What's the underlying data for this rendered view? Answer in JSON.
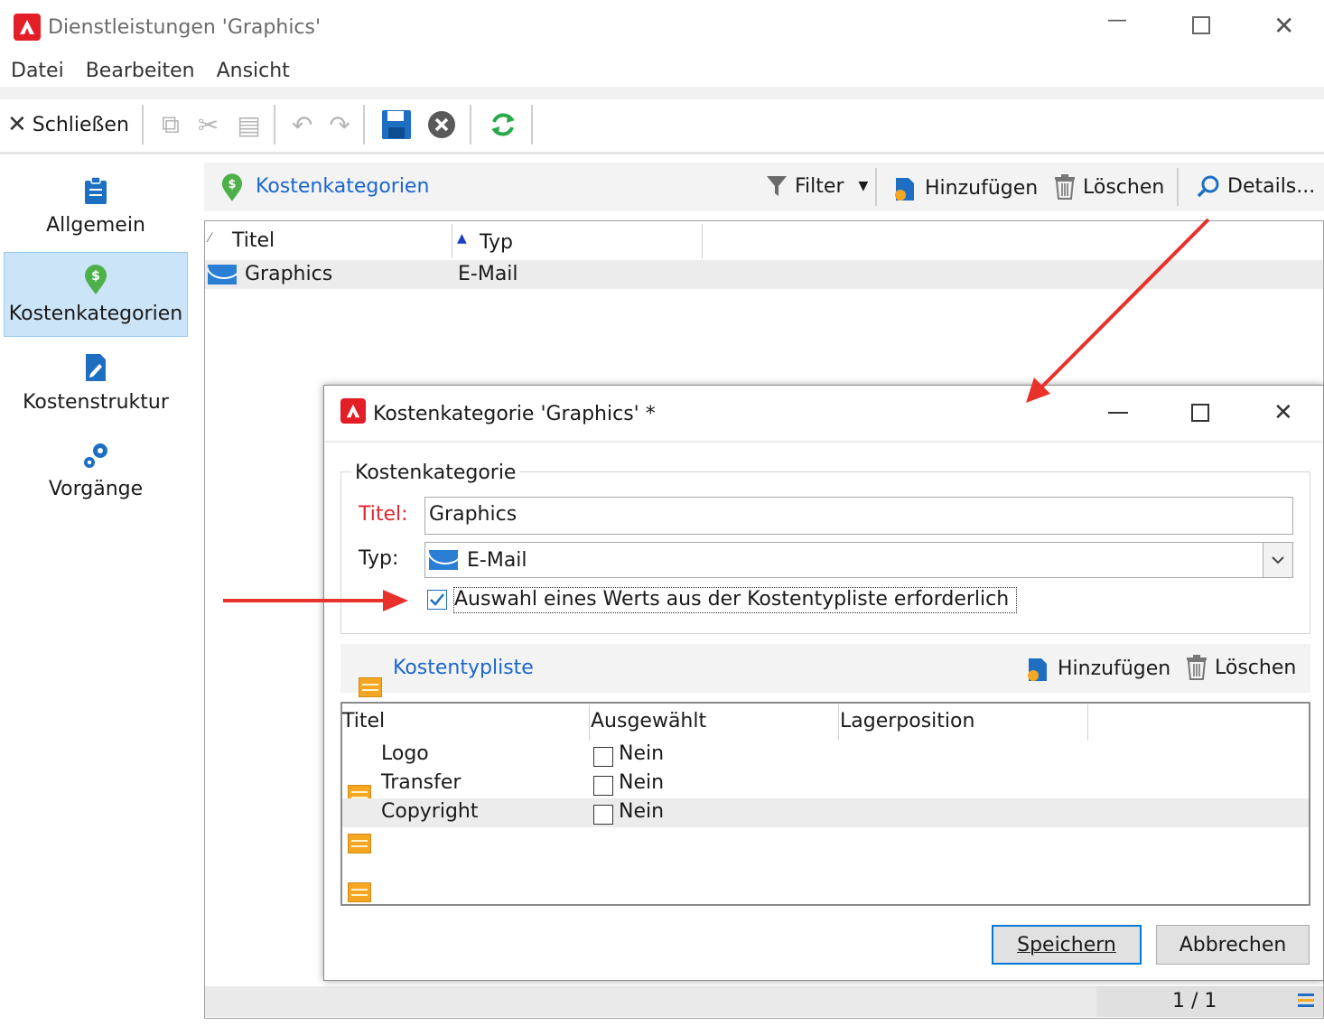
{
  "window": {
    "title": "Dienstleistungen 'Graphics'"
  },
  "menu": [
    "Datei",
    "Bearbeiten",
    "Ansicht"
  ],
  "toolbar": {
    "close_label": "Schließen"
  },
  "nav": [
    {
      "label": "Allgemein",
      "icon": "clipboard-icon"
    },
    {
      "label": "Kostenkategorien",
      "icon": "dollar-pin-icon"
    },
    {
      "label": "Kostenstruktur",
      "icon": "edit-doc-icon"
    },
    {
      "label": "Vorgänge",
      "icon": "gears-icon"
    }
  ],
  "panel": {
    "title": "Kostenkategorien",
    "filter": "Filter",
    "add": "Hinzufügen",
    "delete": "Löschen",
    "details": "Details...",
    "columns": [
      "Titel",
      "Typ"
    ],
    "rows": [
      {
        "title": "Graphics",
        "type": "E-Mail"
      }
    ],
    "pager": "1 / 1"
  },
  "dialog": {
    "title": "Kostenkategorie 'Graphics' *",
    "group": "Kostenkategorie",
    "title_label": "Titel:",
    "title_value": "Graphics",
    "type_label": "Typ:",
    "type_value": "E-Mail",
    "checkbox_label": "Auswahl eines Werts aus der Kostentypliste erforderlich",
    "checkbox_checked": true,
    "sublist_title": "Kostentypliste",
    "sub_add": "Hinzufügen",
    "sub_delete": "Löschen",
    "sub_columns": [
      "Titel",
      "Ausgewählt",
      "Lagerposition"
    ],
    "sub_rows": [
      {
        "title": "Logo",
        "selected": "Nein"
      },
      {
        "title": "Transfer",
        "selected": "Nein"
      },
      {
        "title": "Copyright",
        "selected": "Nein"
      }
    ],
    "save": "Speichern",
    "cancel": "Abbrechen"
  },
  "colors": {
    "accent_red": "#e41e26",
    "link_blue": "#1a66cc",
    "arrow_red": "#e8312a"
  }
}
